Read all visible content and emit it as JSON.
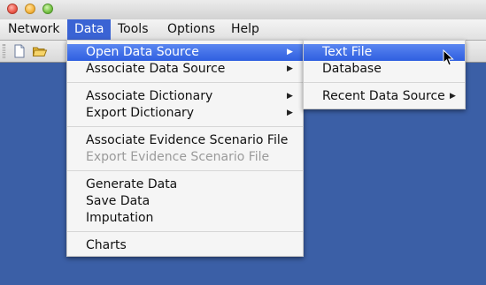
{
  "window": {
    "title": ""
  },
  "menubar": {
    "items": [
      {
        "label": "Network"
      },
      {
        "label": "Data"
      },
      {
        "label": "Tools"
      },
      {
        "label": "Options"
      },
      {
        "label": "Help"
      }
    ],
    "active": "Data"
  },
  "toolbar": {
    "buttons": [
      {
        "icon": "new-document-icon"
      },
      {
        "icon": "open-folder-icon"
      }
    ]
  },
  "data_menu": {
    "items": [
      {
        "label": "Open Data Source",
        "submenu": true,
        "highlighted": true,
        "enabled": true
      },
      {
        "label": "Associate Data Source",
        "submenu": true,
        "enabled": true
      },
      {
        "label": "Associate Dictionary",
        "submenu": true,
        "enabled": true
      },
      {
        "label": "Export Dictionary",
        "submenu": true,
        "enabled": true
      },
      {
        "label": "Associate Evidence Scenario File",
        "enabled": true
      },
      {
        "label": "Export Evidence Scenario File",
        "enabled": false
      },
      {
        "label": "Generate Data",
        "enabled": true
      },
      {
        "label": "Save Data",
        "enabled": true
      },
      {
        "label": "Imputation",
        "enabled": true
      },
      {
        "label": "Charts",
        "enabled": true
      }
    ]
  },
  "open_data_source_submenu": {
    "items": [
      {
        "label": "Text File",
        "highlighted": true
      },
      {
        "label": "Database"
      },
      {
        "label": "Recent Data Source",
        "submenu": true
      }
    ]
  },
  "colors": {
    "highlight": "#3a63d4",
    "background": "#3b5fa6",
    "menu_bg": "#f5f5f5",
    "disabled_text": "#9a9a9a"
  }
}
